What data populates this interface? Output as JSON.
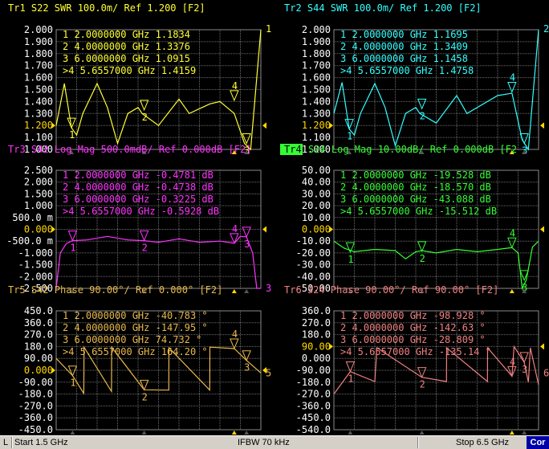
{
  "colors": {
    "background": "#000000",
    "grid": "#6e6e6e",
    "ref_marker": "#ffd700",
    "tr1": "#ffff33",
    "tr2": "#33ffff",
    "tr3": "#ff33ff",
    "tr4": "#33ff33",
    "tr5": "#e8b84a",
    "tr6": "#f08080"
  },
  "panels": [
    {
      "id": "tr1",
      "header": "Tr1  S22  SWR 100.0m/ Ref 1.200 [F2]",
      "color": "#ffff33",
      "ref_color": "#ffd700",
      "yticks": [
        "2.000",
        "1.900",
        "1.800",
        "1.700",
        "1.600",
        "1.500",
        "1.400",
        "1.300",
        "1.200",
        "1.100",
        "1.000"
      ],
      "ref_index": 8,
      "end_label": "1",
      "markers": [
        {
          "num": "1",
          "freq": "2.0000000 GHz",
          "value": "1.1834",
          "unit": ""
        },
        {
          "num": "2",
          "freq": "4.0000000 GHz",
          "value": "1.3376",
          "unit": ""
        },
        {
          "num": "3",
          "freq": "6.0000000 GHz",
          "value": "1.0915",
          "unit": ""
        },
        {
          "num": ">4",
          "freq": "5.6557000 GHz",
          "value": "1.4159",
          "unit": ""
        }
      ],
      "trace": [
        [
          0,
          1.2
        ],
        [
          0.04,
          1.55
        ],
        [
          0.075,
          1.18
        ],
        [
          0.1,
          1.12
        ],
        [
          0.13,
          1.3
        ],
        [
          0.2,
          1.55
        ],
        [
          0.25,
          1.35
        ],
        [
          0.3,
          1.05
        ],
        [
          0.35,
          1.3
        ],
        [
          0.4,
          1.35
        ],
        [
          0.42,
          1.3
        ],
        [
          0.5,
          1.2
        ],
        [
          0.6,
          1.42
        ],
        [
          0.65,
          1.3
        ],
        [
          0.75,
          1.38
        ],
        [
          0.8,
          1.4
        ],
        [
          0.87,
          1.3
        ],
        [
          0.92,
          1.05
        ],
        [
          0.95,
          1.0
        ],
        [
          0.98,
          1.6
        ],
        [
          1.0,
          2.0
        ]
      ],
      "trace_min": 1.0,
      "trace_max": 2.0,
      "marker_pos": [
        [
          0.075,
          1.18
        ],
        [
          0.43,
          1.33
        ],
        [
          0.93,
          1.05
        ],
        [
          0.87,
          1.41
        ]
      ]
    },
    {
      "id": "tr2",
      "header": "Tr2  S44  SWR 100.0m/ Ref 1.200 [F2]",
      "color": "#33ffff",
      "ref_color": "#ffd700",
      "yticks": [
        "2.000",
        "1.900",
        "1.800",
        "1.700",
        "1.600",
        "1.500",
        "1.400",
        "1.300",
        "1.200",
        "1.100",
        "1.000"
      ],
      "ref_index": 8,
      "end_label": "2",
      "markers": [
        {
          "num": "1",
          "freq": "2.0000000 GHz",
          "value": "1.1695",
          "unit": ""
        },
        {
          "num": "2",
          "freq": "4.0000000 GHz",
          "value": "1.3409",
          "unit": ""
        },
        {
          "num": "3",
          "freq": "6.0000000 GHz",
          "value": "1.1458",
          "unit": ""
        },
        {
          "num": ">4",
          "freq": "5.6557000 GHz",
          "value": "1.4758",
          "unit": ""
        }
      ],
      "trace": [
        [
          0,
          1.3
        ],
        [
          0.04,
          1.56
        ],
        [
          0.075,
          1.17
        ],
        [
          0.1,
          1.12
        ],
        [
          0.13,
          1.3
        ],
        [
          0.2,
          1.55
        ],
        [
          0.25,
          1.35
        ],
        [
          0.3,
          1.03
        ],
        [
          0.35,
          1.3
        ],
        [
          0.4,
          1.35
        ],
        [
          0.42,
          1.3
        ],
        [
          0.5,
          1.22
        ],
        [
          0.6,
          1.45
        ],
        [
          0.65,
          1.3
        ],
        [
          0.75,
          1.4
        ],
        [
          0.8,
          1.45
        ],
        [
          0.87,
          1.47
        ],
        [
          0.92,
          1.08
        ],
        [
          0.95,
          1.0
        ],
        [
          0.98,
          1.6
        ],
        [
          1.0,
          2.0
        ]
      ],
      "trace_min": 1.0,
      "trace_max": 2.0,
      "marker_pos": [
        [
          0.075,
          1.17
        ],
        [
          0.43,
          1.34
        ],
        [
          0.93,
          1.05
        ],
        [
          0.87,
          1.48
        ]
      ]
    },
    {
      "id": "tr3",
      "header": "Tr3  S42  Log Mag 500.0mdB/ Ref 0.000dB [F2]",
      "color": "#ff33ff",
      "ref_color": "#ffd700",
      "yticks": [
        "2.500",
        "2.000",
        "1.500",
        "1.000",
        "500.0 m",
        "0.000",
        "-500.0 m",
        "-1.000",
        "-1.500",
        "-2.000",
        "-2.500"
      ],
      "ref_index": 5,
      "end_label": "3",
      "markers": [
        {
          "num": "1",
          "freq": "2.0000000 GHz",
          "value": "-0.4781",
          "unit": "dB"
        },
        {
          "num": "2",
          "freq": "4.0000000 GHz",
          "value": "-0.4738",
          "unit": "dB"
        },
        {
          "num": "3",
          "freq": "6.0000000 GHz",
          "value": "-0.3225",
          "unit": "dB"
        },
        {
          "num": ">4",
          "freq": "5.6557000 GHz",
          "value": "-0.5928",
          "unit": "dB"
        }
      ],
      "trace": [
        [
          0,
          -2.5
        ],
        [
          0.02,
          -1.0
        ],
        [
          0.05,
          -0.6
        ],
        [
          0.08,
          -0.48
        ],
        [
          0.15,
          -0.45
        ],
        [
          0.25,
          -0.3
        ],
        [
          0.35,
          -0.45
        ],
        [
          0.43,
          -0.48
        ],
        [
          0.5,
          -0.55
        ],
        [
          0.6,
          -0.4
        ],
        [
          0.7,
          -0.55
        ],
        [
          0.8,
          -0.5
        ],
        [
          0.87,
          -0.59
        ],
        [
          0.9,
          -0.3
        ],
        [
          0.93,
          -0.32
        ],
        [
          0.96,
          -1.0
        ],
        [
          0.98,
          -2.5
        ],
        [
          1.0,
          -2.5
        ]
      ],
      "trace_min": -2.5,
      "trace_max": 2.5,
      "marker_pos": [
        [
          0.08,
          -0.48
        ],
        [
          0.43,
          -0.47
        ],
        [
          0.93,
          -0.32
        ],
        [
          0.87,
          -0.59
        ]
      ]
    },
    {
      "id": "tr4",
      "header": "Tr4  S24  Log Mag 10.00dB/ Ref 0.000dB [F2",
      "color": "#33ff33",
      "ref_color": "#ffd700",
      "yticks": [
        "50.00",
        "40.00",
        "30.00",
        "20.00",
        "10.00",
        "0.000",
        "-10.00",
        "-20.00",
        "-30.00",
        "-40.00",
        "-50.00"
      ],
      "ref_index": 5,
      "end_label": "",
      "markers": [
        {
          "num": "1",
          "freq": "2.0000000 GHz",
          "value": "-19.528",
          "unit": "dB"
        },
        {
          "num": "2",
          "freq": "4.0000000 GHz",
          "value": "-18.570",
          "unit": "dB"
        },
        {
          "num": "3",
          "freq": "6.0000000 GHz",
          "value": "-43.088",
          "unit": "dB"
        },
        {
          "num": ">4",
          "freq": "5.6557000 GHz",
          "value": "-15.512",
          "unit": "dB"
        }
      ],
      "trace": [
        [
          0,
          -10
        ],
        [
          0.05,
          -16
        ],
        [
          0.1,
          -19
        ],
        [
          0.2,
          -17
        ],
        [
          0.3,
          -18
        ],
        [
          0.35,
          -25
        ],
        [
          0.4,
          -19
        ],
        [
          0.43,
          -18
        ],
        [
          0.5,
          -20
        ],
        [
          0.6,
          -17
        ],
        [
          0.7,
          -19
        ],
        [
          0.8,
          -17
        ],
        [
          0.87,
          -15.5
        ],
        [
          0.9,
          -20
        ],
        [
          0.92,
          -50
        ],
        [
          0.94,
          -43
        ],
        [
          0.97,
          -15
        ],
        [
          1.0,
          -10
        ]
      ],
      "trace_min": -50,
      "trace_max": 50,
      "marker_pos": [
        [
          0.08,
          -19.5
        ],
        [
          0.43,
          -18.6
        ],
        [
          0.93,
          -43.1
        ],
        [
          0.87,
          -15.5
        ]
      ]
    },
    {
      "id": "tr5",
      "header": "Tr5  S42  Phase 90.00°/ Ref 0.000° [F2]",
      "color": "#e8b84a",
      "ref_color": "#ffd700",
      "yticks": [
        "450.0",
        "360.0",
        "270.0",
        "180.0",
        "90.00",
        "0.000",
        "-90.00",
        "-180.0",
        "-270.0",
        "-360.0",
        "-450.0"
      ],
      "ref_index": 5,
      "end_label": "5",
      "markers": [
        {
          "num": "1",
          "freq": "2.0000000 GHz",
          "value": "-40.783",
          "unit": "°"
        },
        {
          "num": "2",
          "freq": "4.0000000 GHz",
          "value": "-147.95",
          "unit": "°"
        },
        {
          "num": "3",
          "freq": "6.0000000 GHz",
          "value": "74.732",
          "unit": "°"
        },
        {
          "num": ">4",
          "freq": "5.6557000 GHz",
          "value": "164.20",
          "unit": "°"
        }
      ],
      "trace": [
        [
          0,
          90
        ],
        [
          0.08,
          -40
        ],
        [
          0.135,
          -175
        ],
        [
          0.136,
          175
        ],
        [
          0.27,
          -160
        ],
        [
          0.271,
          175
        ],
        [
          0.43,
          -148
        ],
        [
          0.55,
          -150
        ],
        [
          0.551,
          170
        ],
        [
          0.75,
          -150
        ],
        [
          0.751,
          175
        ],
        [
          0.87,
          164
        ],
        [
          0.93,
          75
        ],
        [
          1.0,
          -20
        ]
      ],
      "trace_min": -450,
      "trace_max": 450,
      "marker_pos": [
        [
          0.08,
          -40.8
        ],
        [
          0.43,
          -148
        ],
        [
          0.93,
          74.7
        ],
        [
          0.87,
          164.2
        ]
      ]
    },
    {
      "id": "tr6",
      "header": "Tr6  S24  Phase 90.00°/ Ref 90.00° [F2]",
      "color": "#f08080",
      "ref_color": "#ffd700",
      "yticks": [
        "360.0",
        "270.0",
        "180.0",
        "90.00",
        "0.000",
        "-90.00",
        "-180.0",
        "-270.0",
        "-360.0",
        "-450.0",
        "-540.0"
      ],
      "ref_index": 3,
      "end_label": "6",
      "markers": [
        {
          "num": "1",
          "freq": "2.0000000 GHz",
          "value": "-98.928",
          "unit": "°"
        },
        {
          "num": "2",
          "freq": "4.0000000 GHz",
          "value": "-142.63",
          "unit": "°"
        },
        {
          "num": "3",
          "freq": "6.0000000 GHz",
          "value": "-28.809",
          "unit": "°"
        },
        {
          "num": ">4",
          "freq": "5.6557000 GHz",
          "value": "-135.14",
          "unit": "°"
        }
      ],
      "trace": [
        [
          0,
          -270
        ],
        [
          0.08,
          -100
        ],
        [
          0.2,
          -175
        ],
        [
          0.21,
          80
        ],
        [
          0.43,
          -143
        ],
        [
          0.55,
          -175
        ],
        [
          0.551,
          80
        ],
        [
          0.75,
          -175
        ],
        [
          0.751,
          80
        ],
        [
          0.87,
          -135
        ],
        [
          0.88,
          90
        ],
        [
          0.93,
          -29
        ],
        [
          0.95,
          -180
        ],
        [
          0.96,
          80
        ],
        [
          1.0,
          -200
        ]
      ],
      "trace_min": -540,
      "trace_max": 360,
      "marker_pos": [
        [
          0.08,
          -98.9
        ],
        [
          0.43,
          -142.6
        ],
        [
          0.93,
          -28.8
        ],
        [
          0.87,
          -135.1
        ]
      ]
    }
  ],
  "statusbar": {
    "left_label": "L",
    "start": "Start 1.5 GHz",
    "ifbw": "IFBW 70 kHz",
    "stop": "Stop 6.5 GHz",
    "cor": "Cor"
  }
}
